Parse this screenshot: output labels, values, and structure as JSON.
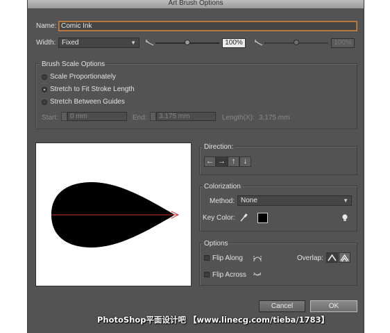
{
  "window": {
    "title": "Art Brush Options"
  },
  "name": {
    "label": "Name:",
    "value": "Comic Ink"
  },
  "width": {
    "label": "Width:",
    "selected": "Fixed",
    "percent": "100%",
    "percent_disabled": "100%",
    "slider_value": 0.5,
    "slider_value_disabled": 0.5
  },
  "brush_scale": {
    "title": "Brush Scale Options",
    "options": [
      {
        "label": "Scale Proportionately",
        "selected": false
      },
      {
        "label": "Stretch to Fit Stroke Length",
        "selected": true
      },
      {
        "label": "Stretch Between Guides",
        "selected": false
      }
    ],
    "start_label": "Start:",
    "start_value": "0 mm",
    "end_label": "End:",
    "end_value": "3,175 mm",
    "length_label": "Length(X):",
    "length_value": "3,175 mm"
  },
  "direction": {
    "title": "Direction:",
    "buttons": [
      {
        "glyph": "←",
        "name": "left"
      },
      {
        "glyph": "→",
        "name": "right",
        "active": true
      },
      {
        "glyph": "↑",
        "name": "up"
      },
      {
        "glyph": "↓",
        "name": "down"
      }
    ]
  },
  "colorization": {
    "title": "Colorization",
    "method_label": "Method:",
    "method_value": "None",
    "key_color_label": "Key Color:",
    "key_color": "#000000"
  },
  "options": {
    "title": "Options",
    "flip_along": "Flip Along",
    "flip_across": "Flip Across",
    "overlap_label": "Overlap:"
  },
  "buttons": {
    "cancel": "Cancel",
    "ok": "OK"
  },
  "watermark": "PhotoShop平面设计吧 【www.linecg.com/tieba/1783】",
  "colors": {
    "dialog_bg": "#535353",
    "focus_ring": "#c9823f",
    "stroke_line": "#d03030"
  }
}
